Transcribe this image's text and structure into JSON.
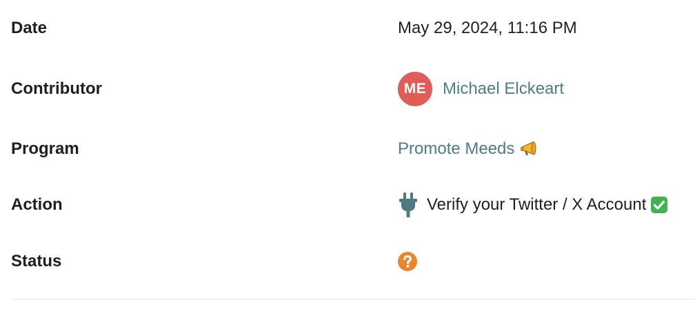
{
  "details": {
    "date": {
      "label": "Date",
      "value": "May 29, 2024, 11:16 PM"
    },
    "contributor": {
      "label": "Contributor",
      "avatar_initials": "ME",
      "avatar_color": "#e05d57",
      "name": "Michael Elckeart"
    },
    "program": {
      "label": "Program",
      "name": "Promote Meeds",
      "icon": "megaphone-icon"
    },
    "action": {
      "label": "Action",
      "icon": "plug-icon",
      "icon_color": "#4f7a83",
      "name": "Verify your Twitter / X Account",
      "suffix_icon": "check-mark-icon",
      "suffix_icon_color": "#3fb34f"
    },
    "status": {
      "label": "Status",
      "icon": "question-circle-icon",
      "icon_color": "#e8862f"
    }
  },
  "colors": {
    "link": "#4c7d86",
    "text": "#1f1f1f",
    "divider": "#e4e4e4"
  }
}
